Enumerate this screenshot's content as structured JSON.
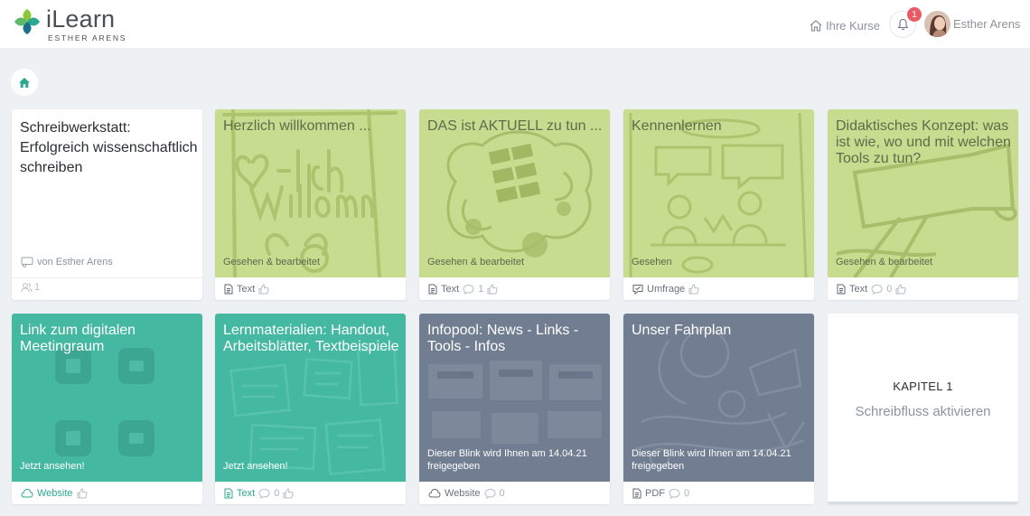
{
  "header": {
    "brand": "iLearn",
    "subtitle": "ESTHER ARENS",
    "nav_courses": "Ihre Kurse",
    "notification_count": "1",
    "user_name": "Esther Arens"
  },
  "colors": {
    "green_tile": "#c7dc8f",
    "teal_tile": "#44b8a1",
    "slate_tile": "#717e91",
    "badge": "#e95a67",
    "accent": "#2ba88f"
  },
  "cards": [
    {
      "title": "Schreibwerkstatt: Erfolgreich wissenschaftlich schreiben",
      "author": "von Esther Arens",
      "members": "1"
    },
    {
      "title": "Herzlich willkommen ...",
      "status": "Gesehen & bearbeitet",
      "type": "Text",
      "type_icon": "document-icon"
    },
    {
      "title": "DAS ist AKTUELL zu tun ...",
      "status": "Gesehen & bearbeitet",
      "type": "Text",
      "type_icon": "document-icon",
      "comments": "1"
    },
    {
      "title": "Kennenlernen",
      "status": "Gesehen",
      "type": "Umfrage",
      "type_icon": "poll-icon"
    },
    {
      "title": "Didaktisches Konzept: was ist wie, wo und mit welchen Tools zu tun?",
      "status": "Gesehen & bearbeitet",
      "type": "Text",
      "type_icon": "document-icon",
      "comments": "0"
    },
    {
      "title": "Link zum digitalen Meetingraum",
      "status": "Jetzt ansehen!",
      "type": "Website",
      "type_icon": "cloud-icon"
    },
    {
      "title": "Lernmaterialien: Handout, Arbeitsblätter, Textbeispiele",
      "status": "Jetzt ansehen!",
      "type": "Text",
      "type_icon": "document-icon",
      "comments": "0"
    },
    {
      "title": "Infopool: News - Links - Tools - Infos",
      "status": "Dieser Blink wird Ihnen am 14.04.21 freigegeben",
      "type": "Website",
      "type_icon": "cloud-icon",
      "comments": "0"
    },
    {
      "title": "Unser Fahrplan",
      "status": "Dieser Blink wird Ihnen am 14.04.21 freigegeben",
      "type": "PDF",
      "type_icon": "document-icon",
      "comments": "0"
    },
    {
      "chapter": "KAPITEL 1",
      "chapter_title": "Schreibfluss aktivieren"
    }
  ]
}
